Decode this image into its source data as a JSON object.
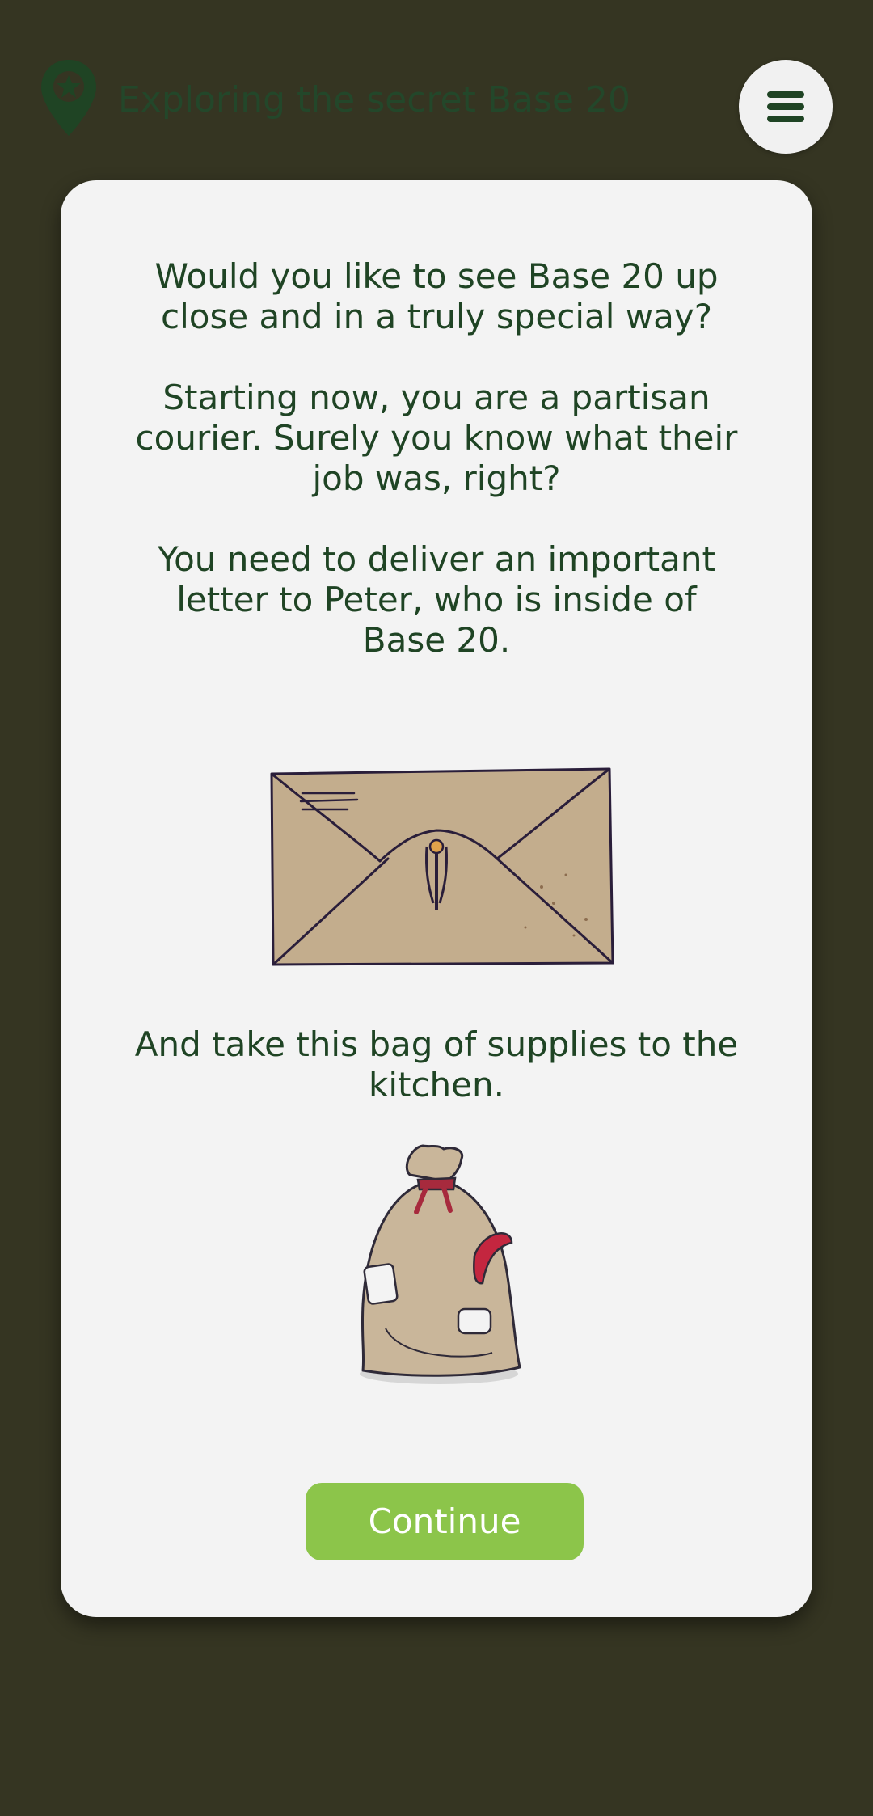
{
  "header": {
    "title": "Exploring the secret Base 20",
    "location_icon": "map-pin-star-icon",
    "menu_icon": "hamburger-menu-icon"
  },
  "card": {
    "paragraph_1": "Would you like to see Base 20 up close and in a truly special way?",
    "paragraph_2": "Starting now, you are a partisan courier. Surely you know what their job was, right?",
    "paragraph_3": "You need to deliver an important letter to Peter, who is inside of Base 20.",
    "illustration_1": "envelope-illustration",
    "paragraph_4": "And take this bag of supplies to the kitchen.",
    "illustration_2": "supply-bag-illustration",
    "continue_label": "Continue"
  },
  "colors": {
    "background": "#353522",
    "card": "#f3f3f3",
    "text": "#1f4424",
    "accent_green": "#8cc54a",
    "header_green": "#23472a"
  }
}
